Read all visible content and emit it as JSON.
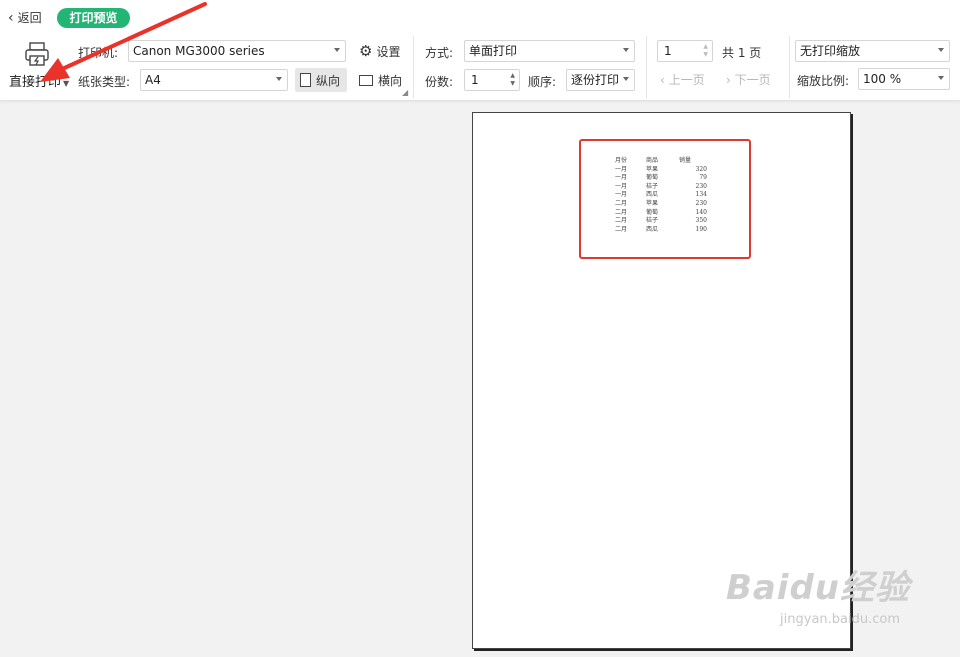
{
  "header": {
    "back_label": "返回",
    "mode_badge": "打印预览"
  },
  "print_action": {
    "label": "直接打印"
  },
  "printer": {
    "label": "打印机:",
    "value": "Canon MG3000 series",
    "settings_label": "设置"
  },
  "paper": {
    "label": "纸张类型:",
    "value": "A4"
  },
  "orientation": {
    "portrait_label": "纵向",
    "landscape_label": "横向",
    "selected": "portrait"
  },
  "mode": {
    "label": "方式:",
    "value": "单面打印"
  },
  "copies": {
    "label": "份数:",
    "value": "1"
  },
  "order": {
    "label": "顺序:",
    "value": "逐份打印"
  },
  "pagination": {
    "current": "1",
    "total_label": "共 1 页",
    "prev_label": "上一页",
    "next_label": "下一页"
  },
  "scaling": {
    "value": "无打印缩放",
    "ratio_label": "缩放比例:",
    "ratio_value": "100 %"
  },
  "sheet": {
    "headers": [
      "月份",
      "商品",
      "销量"
    ],
    "rows": [
      [
        "一月",
        "苹果",
        "320"
      ],
      [
        "一月",
        "葡萄",
        "79"
      ],
      [
        "一月",
        "桔子",
        "230"
      ],
      [
        "一月",
        "西瓜",
        "134"
      ],
      [
        "二月",
        "苹果",
        "230"
      ],
      [
        "二月",
        "葡萄",
        "140"
      ],
      [
        "二月",
        "桔子",
        "350"
      ],
      [
        "二月",
        "西瓜",
        "190"
      ]
    ]
  },
  "watermark": {
    "brand": "Baidu经验",
    "url": "jingyan.baidu.com"
  },
  "colors": {
    "accent": "#22b573",
    "highlight": "#e03a2e"
  }
}
